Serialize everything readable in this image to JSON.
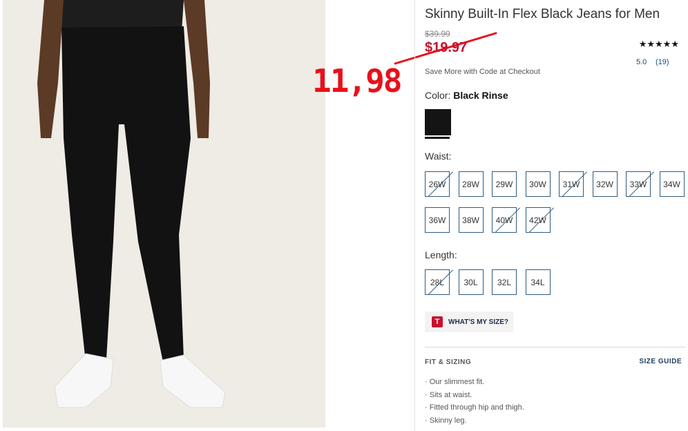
{
  "product": {
    "title": "Skinny Built-In Flex Black Jeans for Men",
    "original_price": "$39.99",
    "sale_price": "$19.97",
    "promo_text": "Save More with Code at Checkout",
    "stars": "★★★★★",
    "rating": "5.0",
    "review_count": "(19)"
  },
  "annotation": {
    "handwritten_price": "11,98",
    "color": "#e8101a"
  },
  "color": {
    "label": "Color:",
    "value": "Black Rinse",
    "swatch_color": "#141414"
  },
  "waist": {
    "label": "Waist:",
    "sizes": [
      {
        "label": "26W",
        "available": false
      },
      {
        "label": "28W",
        "available": true
      },
      {
        "label": "29W",
        "available": true
      },
      {
        "label": "30W",
        "available": true
      },
      {
        "label": "31W",
        "available": false
      },
      {
        "label": "32W",
        "available": true
      },
      {
        "label": "33W",
        "available": false
      },
      {
        "label": "34W",
        "available": true
      },
      {
        "label": "36W",
        "available": true
      },
      {
        "label": "38W",
        "available": true
      },
      {
        "label": "40W",
        "available": false
      },
      {
        "label": "42W",
        "available": false
      }
    ]
  },
  "length": {
    "label": "Length:",
    "sizes": [
      {
        "label": "28L",
        "available": false
      },
      {
        "label": "30L",
        "available": true
      },
      {
        "label": "32L",
        "available": true
      },
      {
        "label": "34L",
        "available": true
      }
    ]
  },
  "size_help": {
    "icon": "T",
    "label": "WHAT'S MY SIZE?"
  },
  "fit": {
    "title": "FIT & SIZING",
    "size_guide": "SIZE GUIDE",
    "bullets": [
      "Our slimmest fit.",
      "Sits at waist.",
      "Fitted through hip and thigh.",
      "Skinny leg."
    ]
  },
  "colors": {
    "sale_red": "#c8102e",
    "border_blue": "#2f5a7e"
  }
}
